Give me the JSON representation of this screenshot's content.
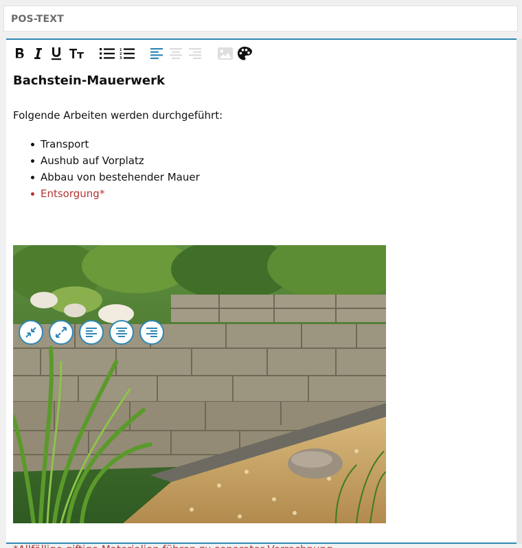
{
  "header": {
    "title": "POS-TEXT"
  },
  "toolbar": {
    "buttons": [
      "bold",
      "italic",
      "underline",
      "text-size",
      "bullet-list",
      "numbered-list",
      "align-left",
      "align-center",
      "align-right",
      "insert-image",
      "text-color"
    ]
  },
  "content": {
    "heading": "Bachstein-Mauerwerk",
    "intro": "Folgende Arbeiten werden durchgeführt:",
    "items": [
      {
        "label": "Transport"
      },
      {
        "label": "Aushub auf Vorplatz"
      },
      {
        "label": "Abbau von bestehender Mauer"
      },
      {
        "label": "Entsorgung*"
      }
    ],
    "footnote": "*Allfällige giftige Materialien führen zu separater Verrechnung."
  },
  "image_controls": [
    "shrink-icon",
    "expand-icon",
    "align-left-icon",
    "align-center-icon",
    "align-right-icon"
  ],
  "colors": {
    "accent": "#2f86b4",
    "red_text": "#b33434",
    "header_text": "#6b6b6b"
  }
}
